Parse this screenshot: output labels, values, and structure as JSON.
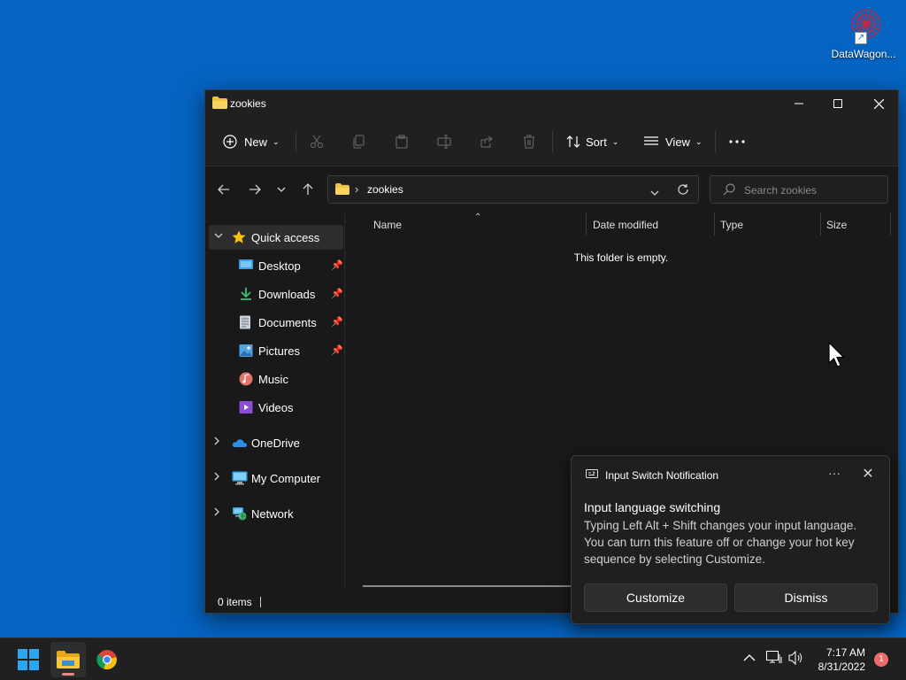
{
  "desktop": {
    "icons": [
      {
        "label": "DataWagon...",
        "icon": "datawagon-shortcut-icon"
      }
    ]
  },
  "explorer": {
    "title": "zookies",
    "toolbar": {
      "new_label": "New",
      "sort_label": "Sort",
      "view_label": "View",
      "icons": [
        "cut-icon",
        "copy-icon",
        "paste-icon",
        "rename-icon",
        "share-icon",
        "delete-icon",
        "more-icon"
      ]
    },
    "address": {
      "path": "zookies",
      "search_placeholder": "Search zookies"
    },
    "sidebar": {
      "quick_access": "Quick access",
      "pinned": [
        {
          "label": "Desktop",
          "icon": "desktop-icon"
        },
        {
          "label": "Downloads",
          "icon": "downloads-icon"
        },
        {
          "label": "Documents",
          "icon": "documents-icon"
        },
        {
          "label": "Pictures",
          "icon": "pictures-icon"
        },
        {
          "label": "Music",
          "icon": "music-icon"
        },
        {
          "label": "Videos",
          "icon": "videos-icon"
        }
      ],
      "sections": [
        {
          "label": "OneDrive",
          "icon": "onedrive-icon"
        },
        {
          "label": "My Computer",
          "icon": "computer-icon"
        },
        {
          "label": "Network",
          "icon": "network-icon"
        }
      ]
    },
    "columns": [
      "Name",
      "Date modified",
      "Type",
      "Size"
    ],
    "empty_message": "This folder is empty.",
    "status": "0 items"
  },
  "notification": {
    "app_name": "Input Switch Notification",
    "more_label": "···",
    "close_label": "✕",
    "heading": "Input language switching",
    "body": "Typing Left Alt + Shift changes your input language. You can turn this feature off or change your hot key sequence by selecting Customize.",
    "customize_label": "Customize",
    "dismiss_label": "Dismiss"
  },
  "taskbar": {
    "time": "7:17 AM",
    "date": "8/31/2022",
    "notification_count": "1",
    "apps": [
      "start-icon",
      "file-explorer-icon",
      "chrome-icon"
    ]
  },
  "colors": {
    "desktop_bg": "#0563c1",
    "window_bg": "#191919",
    "toolbar_bg": "#202020",
    "accent_star": "#f4c20d",
    "badge": "#f06a6a"
  }
}
